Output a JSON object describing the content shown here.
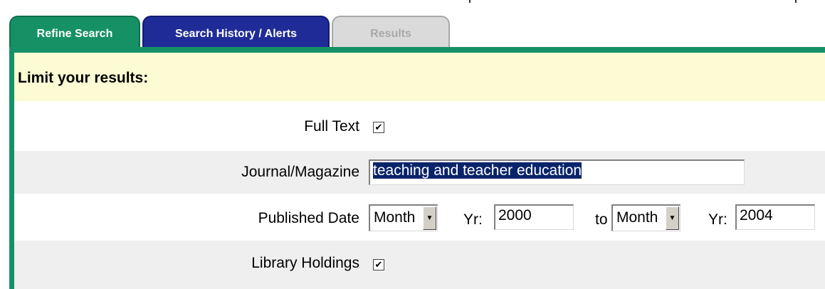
{
  "tabs": {
    "refine_search": "Refine Search",
    "search_history": "Search History / Alerts",
    "results": "Results"
  },
  "panel": {
    "title": "Limit your results:"
  },
  "form": {
    "full_text": {
      "label": "Full Text",
      "checked": true,
      "check_glyph": "✔"
    },
    "journal": {
      "label": "Journal/Magazine",
      "value": "teaching and teacher education"
    },
    "published_date": {
      "label": "Published Date",
      "from_month": "Month",
      "yr_label_from": "Yr:",
      "from_year": "2000",
      "to_label": "to",
      "to_month": "Month",
      "yr_label_to": "Yr:",
      "to_year": "2004"
    },
    "library_holdings": {
      "label": "Library Holdings",
      "checked": true,
      "check_glyph": "✔"
    }
  },
  "icons": {
    "dropdown_arrow": "▼"
  },
  "colors": {
    "green_accent": "#169166",
    "blue_tab": "#1f2c98",
    "header_bg": "#fdfbd3",
    "alt_row_bg": "#efefef",
    "selection_bg": "#0a246a"
  }
}
